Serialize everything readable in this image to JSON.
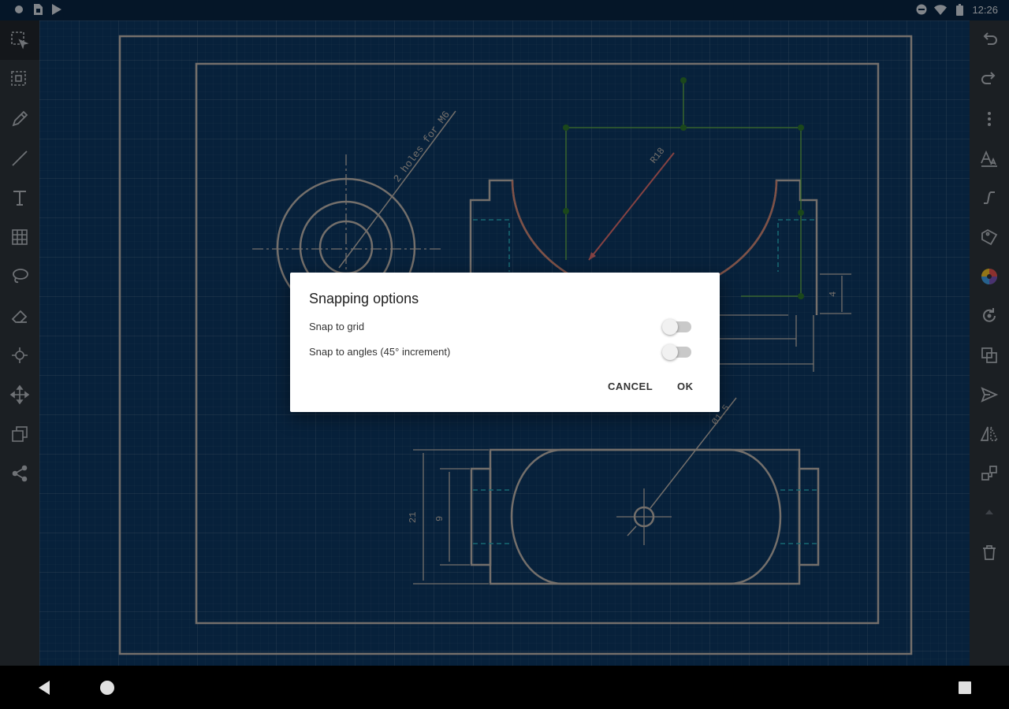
{
  "status_bar": {
    "time": "12:26",
    "left_icons": [
      "circle-notification-icon",
      "sim-card-icon",
      "play-store-icon"
    ],
    "right_icons": [
      "do-not-disturb-icon",
      "wifi-icon",
      "battery-icon"
    ]
  },
  "left_toolbar": {
    "tools": [
      "select-icon",
      "select-area-icon",
      "pencil-icon",
      "line-icon",
      "text-icon",
      "pattern-icon",
      "lasso-icon",
      "eraser-icon",
      "snap-icon",
      "move-icon",
      "copy-icon",
      "share-icon"
    ],
    "active_tool": "select-icon"
  },
  "right_toolbar": {
    "tools": [
      "undo-icon",
      "redo-icon",
      "more-vert-icon",
      "font-size-icon",
      "curve-icon",
      "label-icon",
      "color-palette-icon",
      "rotate-icon",
      "layers-icon",
      "send-icon",
      "mirror-icon",
      "transform-icon",
      "arrow-up-icon",
      "delete-icon"
    ]
  },
  "drawing": {
    "annotations": {
      "hole_note": "2 holes for M6",
      "radius": "R18",
      "dim_height": "4",
      "dim_outer": "21",
      "dim_inner": "9",
      "dim_small_hole": "Ø1.5"
    }
  },
  "dialog": {
    "title": "Snapping options",
    "options": [
      {
        "label": "Snap to grid",
        "enabled": false
      },
      {
        "label": "Snap to angles (45° increment)",
        "enabled": false
      }
    ],
    "cancel_label": "CANCEL",
    "ok_label": "OK"
  },
  "nav_bar": {
    "buttons": [
      "back-icon",
      "home-icon",
      "recents-icon"
    ]
  },
  "colors": {
    "canvas_bg": "#0d3a66",
    "toolbar_bg": "#30363d",
    "drawing_line": "#c8c0b8",
    "accent_red": "#e57373",
    "construction_green": "#6fbf4a",
    "hidden_cyan": "#29b6c6"
  }
}
